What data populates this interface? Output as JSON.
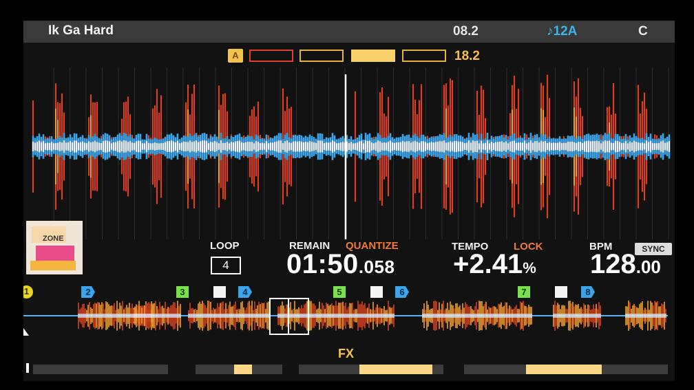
{
  "header": {
    "title": "Ik Ga Hard",
    "elapsed": "08.2",
    "key": "♪12A",
    "corner": "C"
  },
  "phrase": {
    "badge": "A",
    "count": "18.2"
  },
  "artwork": {
    "text": "ZONE"
  },
  "loop": {
    "label": "LOOP",
    "value": "4"
  },
  "time": {
    "remain_label": "REMAIN",
    "quantize_label": "QUANTIZE",
    "main": "01:50",
    "ms": ".058"
  },
  "tempo": {
    "label": "TEMPO",
    "lock_label": "LOCK",
    "main": "+2.41",
    "unit": "%"
  },
  "bpm": {
    "label": "BPM",
    "sync_label": "SYNC",
    "main": "128",
    "decimal": ".00"
  },
  "cues": [
    {
      "label": "1",
      "kind": "memory"
    },
    {
      "label": "2",
      "kind": "hot-blue"
    },
    {
      "label": "3",
      "kind": "hot-green"
    },
    {
      "label": "4",
      "kind": "hot-blue"
    },
    {
      "label": "5",
      "kind": "hot-green"
    },
    {
      "label": "6",
      "kind": "hot-blue"
    },
    {
      "label": "7",
      "kind": "hot-green"
    },
    {
      "label": "8",
      "kind": "hot-blue"
    }
  ],
  "fx": {
    "label": "FX"
  },
  "colors": {
    "accent": "#f5c24a",
    "key": "#38b7e8",
    "wave_peak": "#e0402a",
    "wave_core": "#3aa5ea"
  }
}
